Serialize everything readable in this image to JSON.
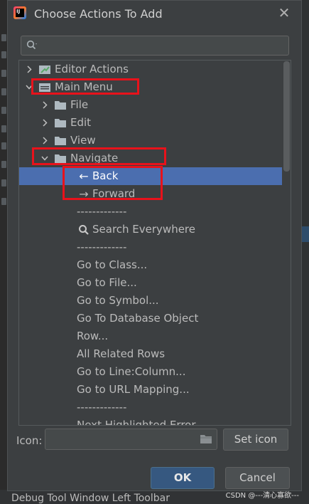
{
  "dialog": {
    "title": "Choose Actions To Add"
  },
  "search": {
    "value": "",
    "placeholder": ""
  },
  "tree": [
    {
      "label": "Editor Actions",
      "kind": "group",
      "icon": "editor-actions-icon",
      "chevron": "collapsed"
    },
    {
      "label": "Main Menu",
      "kind": "group",
      "icon": "menu-icon",
      "chevron": "expanded"
    },
    {
      "label": "File",
      "kind": "folder",
      "icon": "folder-icon",
      "chevron": "collapsed"
    },
    {
      "label": "Edit",
      "kind": "folder",
      "icon": "folder-icon",
      "chevron": "collapsed"
    },
    {
      "label": "View",
      "kind": "folder",
      "icon": "folder-icon",
      "chevron": "collapsed"
    },
    {
      "label": "Navigate",
      "kind": "folder",
      "icon": "folder-icon",
      "chevron": "expanded"
    },
    {
      "label": "Back",
      "kind": "action",
      "icon": "arrow-left-icon",
      "selected": true
    },
    {
      "label": "Forward",
      "kind": "action",
      "icon": "arrow-right-icon"
    },
    {
      "label": "-------------",
      "kind": "separator"
    },
    {
      "label": "Search Everywhere",
      "kind": "action",
      "icon": "search-icon"
    },
    {
      "label": "-------------",
      "kind": "separator"
    },
    {
      "label": "Go to Class...",
      "kind": "action"
    },
    {
      "label": "Go to File...",
      "kind": "action"
    },
    {
      "label": "Go to Symbol...",
      "kind": "action"
    },
    {
      "label": "Go To Database Object",
      "kind": "action"
    },
    {
      "label": "Row...",
      "kind": "action"
    },
    {
      "label": "All Related Rows",
      "kind": "action"
    },
    {
      "label": "Go to Line:Column...",
      "kind": "action"
    },
    {
      "label": "Go to URL Mapping...",
      "kind": "action"
    },
    {
      "label": "-------------",
      "kind": "separator"
    },
    {
      "label": "Next Highlighted Error",
      "kind": "action"
    }
  ],
  "icon_field": {
    "label": "Icon:",
    "value": ""
  },
  "buttons": {
    "set_icon": "Set icon",
    "ok": "OK",
    "cancel": "Cancel"
  },
  "background": {
    "bottom_text": "Debug Tool Window Left Toolbar"
  },
  "watermark": "CSDN @---清心寡欲---",
  "colors": {
    "selection": "#4b6eaf",
    "annotation": "#e8121b",
    "ok_button": "#365880"
  }
}
